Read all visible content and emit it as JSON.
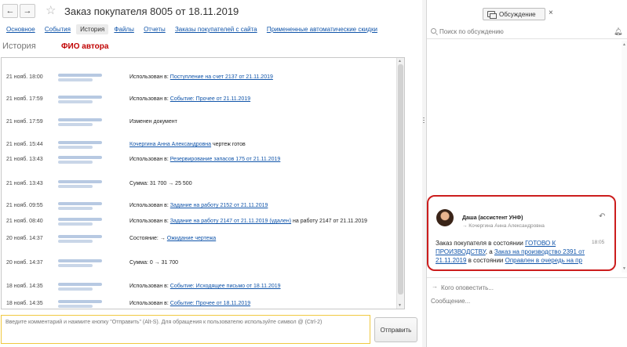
{
  "window": {
    "back_label": "←",
    "forward_label": "→",
    "title": "Заказ покупателя 8005 от 18.11.2019"
  },
  "tabs": [
    {
      "label": "Основное",
      "active": false
    },
    {
      "label": "События",
      "active": false
    },
    {
      "label": "История",
      "active": true
    },
    {
      "label": "Файлы",
      "active": false
    },
    {
      "label": "Отчеты",
      "active": false
    },
    {
      "label": "Заказы покупателей с сайта",
      "active": false
    },
    {
      "label": "Примененные автоматические скидки",
      "active": false
    }
  ],
  "history": {
    "section_title": "История",
    "author_label": "ФИО автора",
    "rows": [
      {
        "date": "21 нояб. 18:00",
        "prefix": "Использован в: ",
        "link": "Поступление на счет 2137 от 21.11.2019",
        "suffix": ""
      },
      {
        "date": "21 нояб. 17:59",
        "prefix": "Использован в: ",
        "link": "Событие: Прочее от 21.11.2019",
        "suffix": ""
      },
      {
        "date": "21 нояб. 17:59",
        "prefix": "Изменен документ",
        "link": "",
        "suffix": ""
      },
      {
        "date": "21 нояб. 15:44",
        "author": "Кочергина Анна Александровна",
        "prefix": "",
        "link": "",
        "suffix": "чертеж готов"
      },
      {
        "date": "21 нояб. 13:43",
        "prefix": "Использован в: ",
        "link": "Резервирование запасов 175 от 21.11.2019",
        "suffix": ""
      },
      {
        "date": "21 нояб. 13:43",
        "prefix": "Сумма: 31 700 → 25 500",
        "link": "",
        "suffix": ""
      },
      {
        "date": "21 нояб. 09:55",
        "prefix": "Использован в: ",
        "link": "Задание на работу 2152 от 21.11.2019",
        "suffix": ""
      },
      {
        "date": "21 нояб. 08:40",
        "prefix": "Использован в: ",
        "link": "Задание на работу 2147 от 21.11.2019 (удален)",
        "suffix": " на работу 2147 от 21.11.2019"
      },
      {
        "date": "20 нояб. 14:37",
        "prefix": "Состояние: → ",
        "link": "Ожидание чертежа",
        "suffix": ""
      },
      {
        "date": "20 нояб. 14:37",
        "prefix": "Сумма: 0 → 31 700",
        "link": "",
        "suffix": ""
      },
      {
        "date": "18 нояб. 14:35",
        "prefix": "Использован в: ",
        "link": "Событие: Исходящее письмо от 18.11.2019",
        "suffix": ""
      },
      {
        "date": "18 нояб. 14:35",
        "prefix": "Использован в: ",
        "link": "Событие: Прочее от 18.11.2019",
        "suffix": ""
      }
    ]
  },
  "comment": {
    "placeholder": "Введите комментарий и нажмите кнопку \"Отправить\" (Alt-S). Для обращения к пользователю используйте символ @ (Ctrl-2)",
    "send_label": "Отправить"
  },
  "discussion": {
    "button_label": "Обсуждение",
    "close_label": "×",
    "search_placeholder": "Поиск по обсуждению",
    "message": {
      "author": "Даша (ассистент УНФ)",
      "subtitle": "→ Кочергина Анна Александровна",
      "time": "18:05",
      "text_1": "Заказ покупателя в состоянии ",
      "link_1": "ГОТОВО К ПРОИЗВОДСТВУ",
      "text_2": ", а ",
      "link_2": "Заказ на производство 2391 от 21.11.2019",
      "text_3": " в состоянии ",
      "link_3": "Оправлен в очередь на пр"
    },
    "notify_placeholder": "Кого оповестить...",
    "message_placeholder": "Сообщение..."
  }
}
